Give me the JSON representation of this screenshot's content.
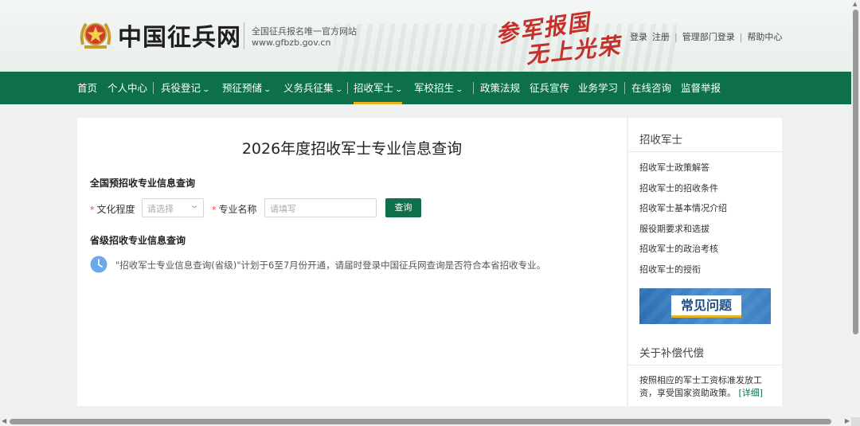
{
  "header": {
    "site_title": "中国征兵网",
    "subtitle": "全国征兵报名唯一官方网站",
    "url": "www.gfbzb.gov.cn",
    "slogan_line1": "参军报国",
    "slogan_line2": "无上光荣",
    "links": [
      "登录",
      "注册",
      "管理部门登录",
      "帮助中心"
    ]
  },
  "nav": {
    "items": [
      {
        "label": "首页",
        "dropdown": false
      },
      {
        "label": "个人中心",
        "dropdown": false
      },
      {
        "label": "兵役登记",
        "dropdown": true
      },
      {
        "label": "预征预储",
        "dropdown": true
      },
      {
        "label": "义务兵征集",
        "dropdown": true
      },
      {
        "label": "招收军士",
        "dropdown": true,
        "active": true
      },
      {
        "label": "军校招生",
        "dropdown": true
      },
      {
        "label": "政策法规",
        "dropdown": false
      },
      {
        "label": "征兵宣传",
        "dropdown": false
      },
      {
        "label": "业务学习",
        "dropdown": false
      },
      {
        "label": "在线咨询",
        "dropdown": false
      },
      {
        "label": "监督举报",
        "dropdown": false
      }
    ],
    "active_underline_color": "#e6b422"
  },
  "main": {
    "page_title": "2026年度招收军士专业信息查询",
    "national_section_title": "全国预招收专业信息查询",
    "required_mark": "*",
    "education_label": "文化程度",
    "education_placeholder": "请选择",
    "major_label": "专业名称",
    "major_placeholder": "请填写",
    "query_button": "查询",
    "provincial_section_title": "省级招收专业信息查询",
    "notice": "\"招收军士专业信息查询(省级)\"计划于6至7月份开通，请届时登录中国征兵网查询是否符合本省招收专业。"
  },
  "sidebar": {
    "heading": "招收军士",
    "links": [
      "招收军士政策解答",
      "招收军士的招收条件",
      "招收军士基本情况介绍",
      "服役期要求和选拔",
      "招收军士的政治考核",
      "招收军士的授衔"
    ],
    "banner_text": "常见问题",
    "compensation_heading": "关于补偿代偿",
    "compensation_text": "按照相应的军士工资标准发放工资，享受国家资助政策。",
    "more_link": "[详细]"
  },
  "colors": {
    "brand_green": "#0e7049",
    "accent_gold": "#e6b422",
    "slogan_red": "#c6302b"
  }
}
